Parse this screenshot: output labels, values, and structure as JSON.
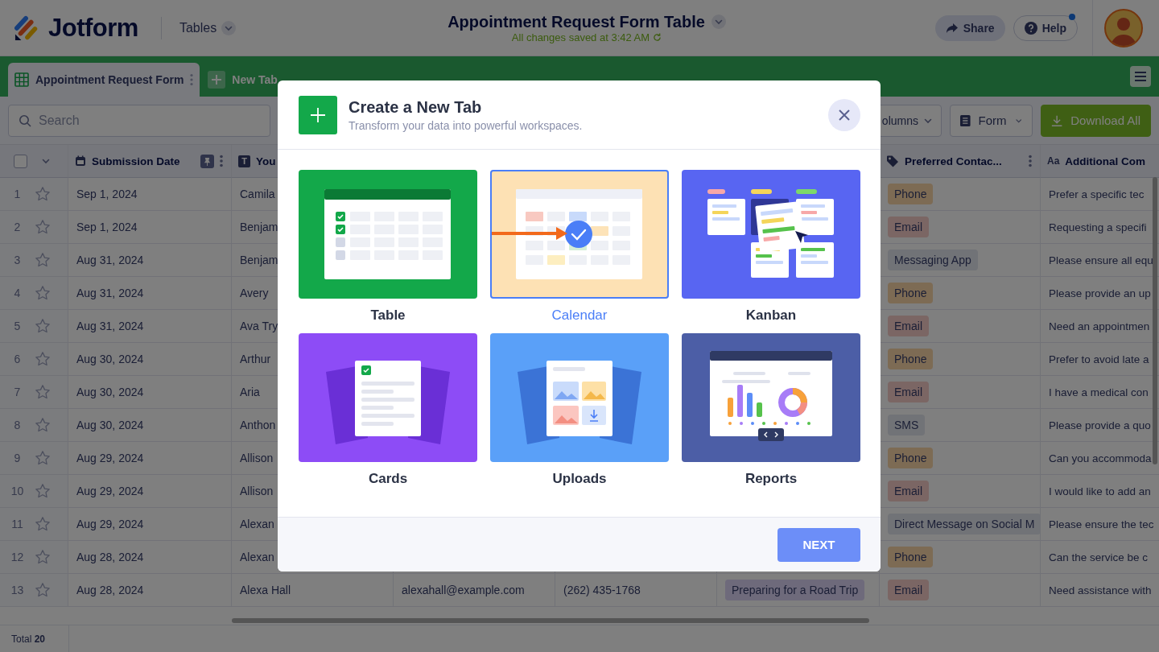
{
  "header": {
    "logo": "Jotform",
    "section": "Tables",
    "title": "Appointment Request Form Table",
    "save_status": "All changes saved at 3:42 AM",
    "buttons": [
      {
        "label": "Share",
        "kind": "share"
      },
      {
        "label": "Help",
        "kind": "help",
        "notification": true
      }
    ]
  },
  "tabs": [
    {
      "label": "Appointment Request Form",
      "kind": "table",
      "selected": true
    },
    {
      "label": "New Tab",
      "kind": "add",
      "selected": false
    }
  ],
  "toolbar": {
    "search": {
      "placeholder": "Search"
    },
    "buttons": [
      {
        "label": "olumns",
        "kind": "dropdown"
      },
      {
        "label": "Form",
        "kind": "form"
      },
      {
        "label": "Download All",
        "kind": "download"
      }
    ]
  },
  "table": {
    "select_all": {
      "checked": false
    },
    "columns": [
      {
        "label": "Submission Date",
        "kind": "date",
        "pinned": true,
        "menu": true
      },
      {
        "label": "You",
        "kind": "text",
        "icon_glyph": "T"
      },
      {
        "label": "Preferred Contac...",
        "kind": "tag",
        "menu": true
      },
      {
        "label": "Additional Com",
        "kind": "longtext",
        "icon_glyph": "Aa"
      }
    ],
    "rows": [
      {
        "number": "1",
        "starred": false,
        "date": "Sep 1, 2024",
        "name": "Camila",
        "contact": {
          "label": "Phone",
          "color": "#7d6b54"
        },
        "comment": "Prefer a specific tec"
      },
      {
        "number": "2",
        "starred": false,
        "date": "Sep 1, 2024",
        "name": "Benjam",
        "contact": {
          "label": "Email",
          "color": "#7b6664"
        },
        "comment": "Requesting a specifi"
      },
      {
        "number": "3",
        "starred": false,
        "date": "Aug 31, 2024",
        "name": "Benjam",
        "contact": {
          "label": "Messaging App",
          "color": "#717377"
        },
        "comment": "Please ensure all equ"
      },
      {
        "number": "4",
        "starred": false,
        "date": "Aug 31, 2024",
        "name": "Avery",
        "contact": {
          "label": "Phone",
          "color": "#7d6b54"
        },
        "comment": "Please provide an up"
      },
      {
        "number": "5",
        "starred": false,
        "date": "Aug 31, 2024",
        "name": "Ava Try",
        "contact": {
          "label": "Email",
          "color": "#7b6664"
        },
        "comment": "Need an appointmen"
      },
      {
        "number": "6",
        "starred": false,
        "date": "Aug 30, 2024",
        "name": "Arthur",
        "contact": {
          "label": "Phone",
          "color": "#7d6b54"
        },
        "comment": "Prefer to avoid late a"
      },
      {
        "number": "7",
        "starred": false,
        "date": "Aug 30, 2024",
        "name": "Aria",
        "contact": {
          "label": "Email",
          "color": "#7b6664"
        },
        "comment": "I have a medical con"
      },
      {
        "number": "8",
        "starred": false,
        "date": "Aug 30, 2024",
        "name": "Anthon",
        "contact": {
          "label": "SMS",
          "color": "#717377"
        },
        "comment": "Please provide a quo"
      },
      {
        "number": "9",
        "starred": false,
        "date": "Aug 29, 2024",
        "name": "Allison",
        "contact": {
          "label": "Phone",
          "color": "#7d6b54"
        },
        "comment": "Can you accommoda"
      },
      {
        "number": "10",
        "starred": false,
        "date": "Aug 29, 2024",
        "name": "Allison",
        "contact": {
          "label": "Email",
          "color": "#7b6664"
        },
        "comment": "I would like to add an"
      },
      {
        "number": "11",
        "starred": false,
        "date": "Aug 29, 2024",
        "name": "Alexan",
        "contact": {
          "label": "Direct Message on Social M",
          "color": "#717377"
        },
        "comment": "Please ensure the tec"
      },
      {
        "number": "12",
        "starred": false,
        "date": "Aug 28, 2024",
        "name": "Alexan",
        "contact": {
          "label": "Phone",
          "color": "#7d6b54"
        },
        "comment": "Can the service be c"
      },
      {
        "number": "13",
        "starred": false,
        "date": "Aug 28, 2024",
        "name": "Alexa Hall",
        "email": "alexahall@example.com",
        "phone": "(262) 435-1768",
        "service": {
          "label": "Preparing for a Road Trip",
          "color": "#6e6a7b"
        },
        "contact": {
          "label": "Email",
          "color": "#7b6664"
        },
        "comment": "Need assistance with"
      }
    ],
    "footer": "Total **20**"
  },
  "modal": {
    "title": "Create a New Tab",
    "subtitle": "Transform your data into powerful workspaces.",
    "options": [
      {
        "label": "Table",
        "kind": "table",
        "selected": false
      },
      {
        "label": "Calendar",
        "kind": "calendar",
        "selected": true
      },
      {
        "label": "Kanban",
        "kind": "kanban",
        "selected": false
      },
      {
        "label": "Cards",
        "kind": "cards",
        "selected": false
      },
      {
        "label": "Uploads",
        "kind": "uploads",
        "selected": false
      },
      {
        "label": "Reports",
        "kind": "reports",
        "selected": false
      }
    ],
    "next": "NEXT"
  }
}
